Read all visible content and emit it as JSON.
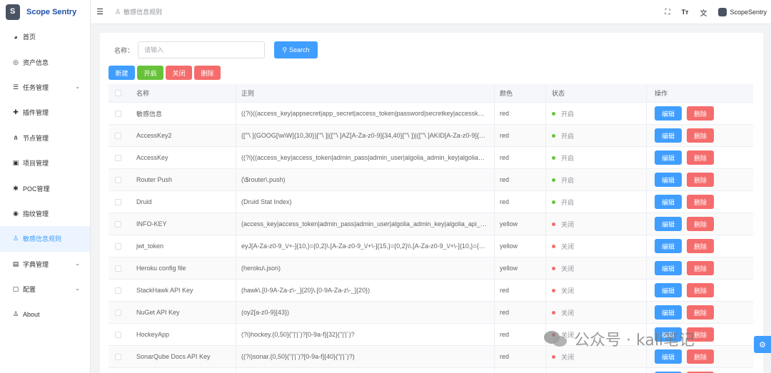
{
  "app": {
    "title": "Scope Sentry"
  },
  "sidebar": {
    "items": [
      {
        "label": "首页",
        "icon": "dashboard-icon",
        "glyph": "◕",
        "has_arrow": false,
        "active": false
      },
      {
        "label": "资产信息",
        "icon": "eye-icon",
        "glyph": "◎",
        "has_arrow": false,
        "active": false
      },
      {
        "label": "任务管理",
        "icon": "list-icon",
        "glyph": "☰",
        "has_arrow": true,
        "active": false
      },
      {
        "label": "插件管理",
        "icon": "puzzle-icon",
        "glyph": "✚",
        "has_arrow": false,
        "active": false
      },
      {
        "label": "节点管理",
        "icon": "nodes-icon",
        "glyph": "⋔",
        "has_arrow": false,
        "active": false
      },
      {
        "label": "项目管理",
        "icon": "project-icon",
        "glyph": "▣",
        "has_arrow": false,
        "active": false
      },
      {
        "label": "POC管理",
        "icon": "bug-icon",
        "glyph": "✱",
        "has_arrow": false,
        "active": false
      },
      {
        "label": "指纹管理",
        "icon": "fingerprint-icon",
        "glyph": "◉",
        "has_arrow": false,
        "active": false
      },
      {
        "label": "敏感信息规则",
        "icon": "person-icon",
        "glyph": "♙",
        "has_arrow": false,
        "active": true
      },
      {
        "label": "字典管理",
        "icon": "book-icon",
        "glyph": "▤",
        "has_arrow": true,
        "active": false
      },
      {
        "label": "配置",
        "icon": "settings-icon",
        "glyph": "▢",
        "has_arrow": true,
        "active": false
      },
      {
        "label": "About",
        "icon": "person-icon",
        "glyph": "♙",
        "has_arrow": false,
        "active": false
      }
    ]
  },
  "header": {
    "breadcrumb": "敏感信息规则",
    "user": "ScopeSentry",
    "icons": [
      "fullscreen-icon",
      "font-size-icon",
      "translate-icon"
    ]
  },
  "filter": {
    "label": "名称：",
    "placeholder": "请输入",
    "search_label": "Search"
  },
  "actions": {
    "new_label": "新建",
    "enable_label": "开启",
    "disable_label": "关闭",
    "delete_label": "删除"
  },
  "table": {
    "columns": {
      "name": "名称",
      "regex": "正则",
      "color": "颜色",
      "status": "状态",
      "ops": "操作"
    },
    "edit_label": "编辑",
    "delete_label": "删除",
    "status_colors": {
      "开启": "#67c23a",
      "关闭": "#f56c6c"
    },
    "rows": [
      {
        "name": "敏感信息",
        "regex": "((?i)((access_key|appsecret|app_secret|access_token|password|secretkey|accesskey|accessk",
        "color": "red",
        "status": "开启"
      },
      {
        "name": "AccessKey2",
        "regex": "([\"'\\ ](GOOG[\\w\\W]{10,30})[\"'\\ ]|([\"'\\ ]AZ[A-Za-z0-9]{34,40}[\"'\\ ])|([\"'\\ ]AKID[A-Za-z0-9]{13,",
        "color": "red",
        "status": "开启"
      },
      {
        "name": "AccessKey",
        "regex": "((?i)((access_key|access_token|admin_pass|admin_user|algolia_admin_key|algolia_api_key|",
        "color": "red",
        "status": "开启"
      },
      {
        "name": "Router Push",
        "regex": "(\\$router\\.push)",
        "color": "red",
        "status": "开启"
      },
      {
        "name": "Druid",
        "regex": "(Druid Stat Index)",
        "color": "red",
        "status": "开启"
      },
      {
        "name": "INFO-KEY",
        "regex": "(access_key|access_token|admin_pass|admin_user|algolia_admin_key|algolia_api_key|alias_pass",
        "color": "yellow",
        "status": "关闭"
      },
      {
        "name": "jwt_token",
        "regex": "eyJ[A-Za-z0-9_\\/+-]{10,}={0,2}\\.[A-Za-z0-9_\\/+\\-]{15,}={0,2}\\\\.[A-Za-z0-9_\\/+\\-]{10,}={0,2}",
        "color": "yellow",
        "status": "关闭"
      },
      {
        "name": "Heroku config file",
        "regex": "(heroku\\.json)",
        "color": "yellow",
        "status": "关闭"
      },
      {
        "name": "StackHawk API Key",
        "regex": "(hawk\\.[0-9A-Za-z\\-_]{20}\\.[0-9A-Za-z\\-_]{20})",
        "color": "red",
        "status": "关闭"
      },
      {
        "name": "NuGet API Key",
        "regex": "(oy2[a-z0-9]{43})",
        "color": "red",
        "status": "关闭"
      },
      {
        "name": "HockeyApp",
        "regex": "(?i)hockey.{0,50}(\"|'|`)?[0-9a-f]{32}(\"|'|`)?",
        "color": "red",
        "status": "关闭"
      },
      {
        "name": "SonarQube Docs API Key",
        "regex": "((?i)sonar.{0,50}(\"|'|`)?[0-9a-f]{40}(\"|'|`)?)",
        "color": "red",
        "status": "关闭"
      },
      {
        "name": "",
        "regex": "",
        "color": "",
        "status": ""
      }
    ]
  },
  "watermark": {
    "text": "公众号 · kali笔记"
  }
}
